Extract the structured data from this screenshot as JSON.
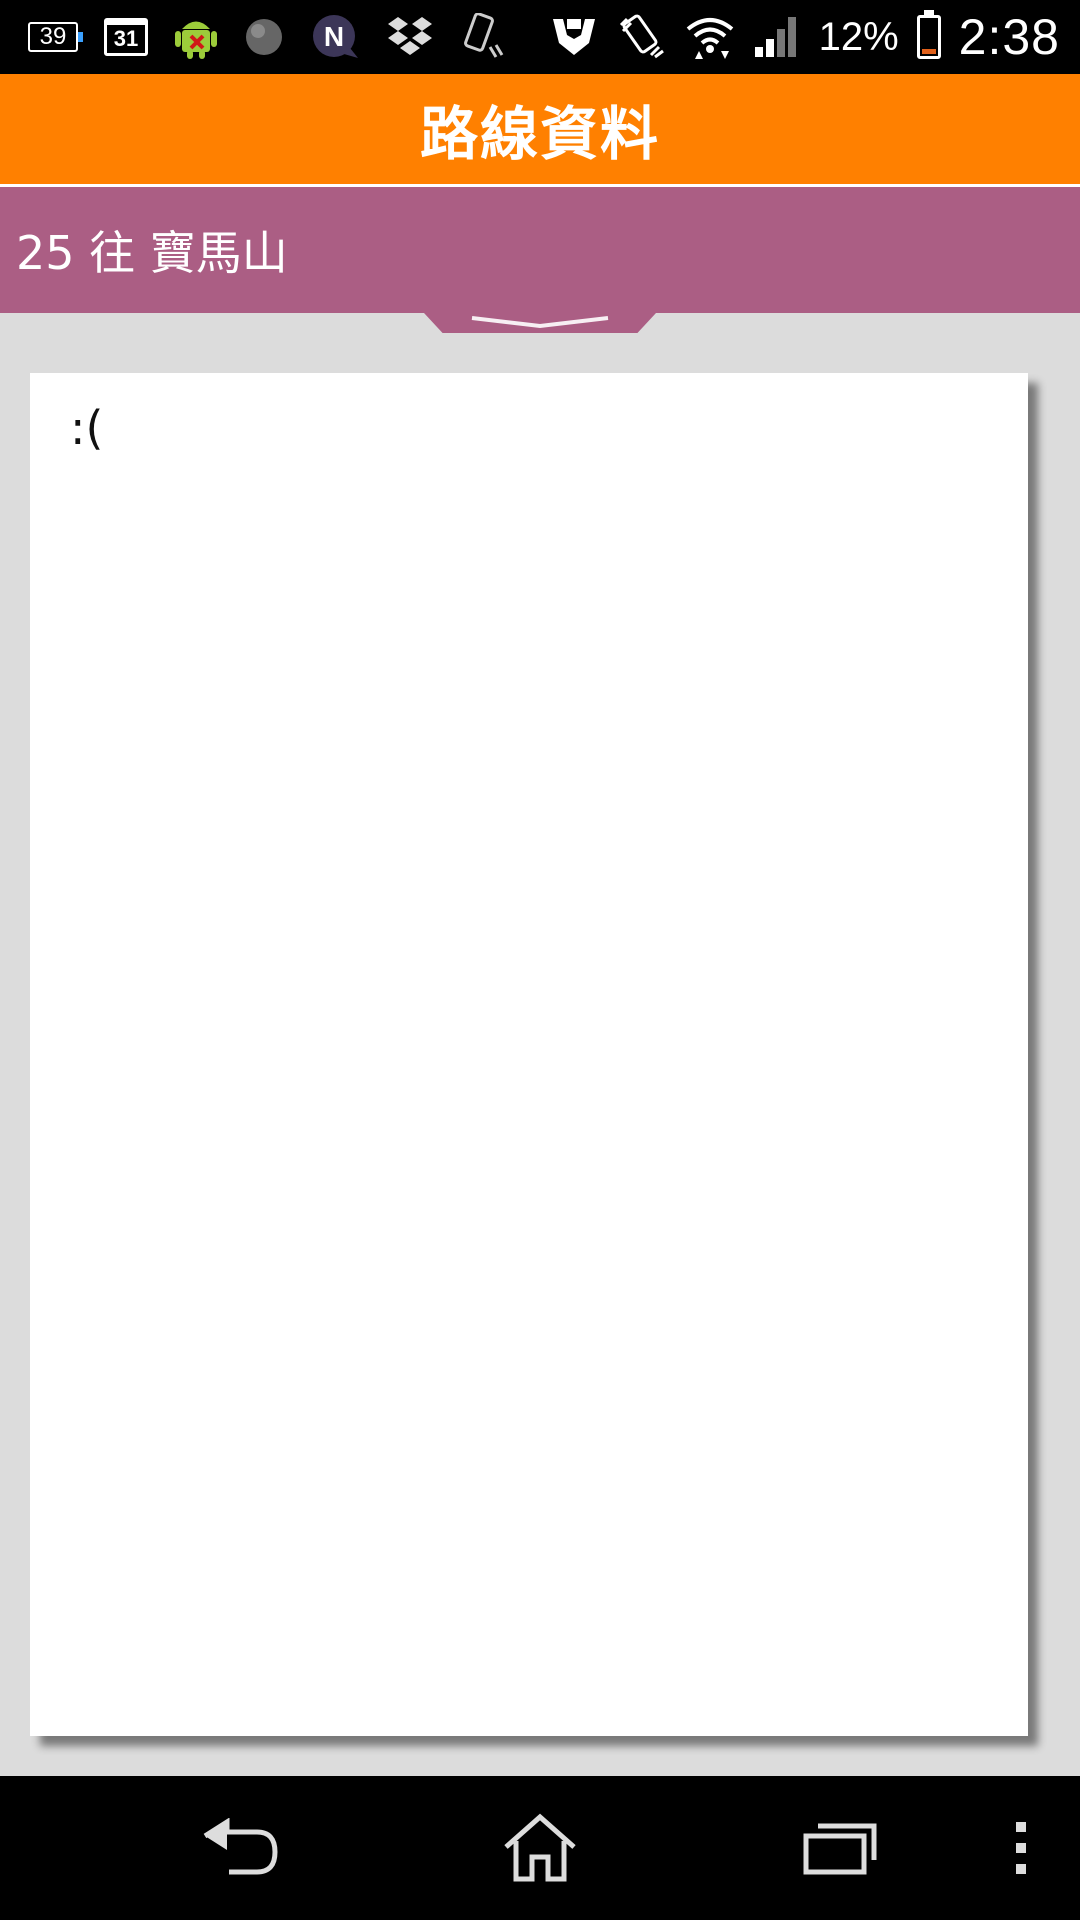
{
  "status_bar": {
    "notification_count": "39",
    "calendar_day": "31",
    "battery_percent": "12%",
    "battery_level": 0.12,
    "time": "2:38",
    "icons": [
      "notification-count-icon",
      "calendar-icon",
      "android-debug-icon",
      "sphere-icon",
      "n-app-icon",
      "dropbox-icon",
      "phone-tilt-icon",
      "shield-hands-icon",
      "vibrate-icon",
      "wifi-icon",
      "signal-icon",
      "battery-icon"
    ]
  },
  "header": {
    "title": "路線資料",
    "color": "#ff8000"
  },
  "route": {
    "label": "25 往 寶馬山",
    "color": "#ab5e84"
  },
  "content": {
    "message": ":("
  },
  "nav_bar": {
    "icons": [
      "back-icon",
      "home-icon",
      "recent-apps-icon",
      "overflow-menu-icon"
    ]
  }
}
